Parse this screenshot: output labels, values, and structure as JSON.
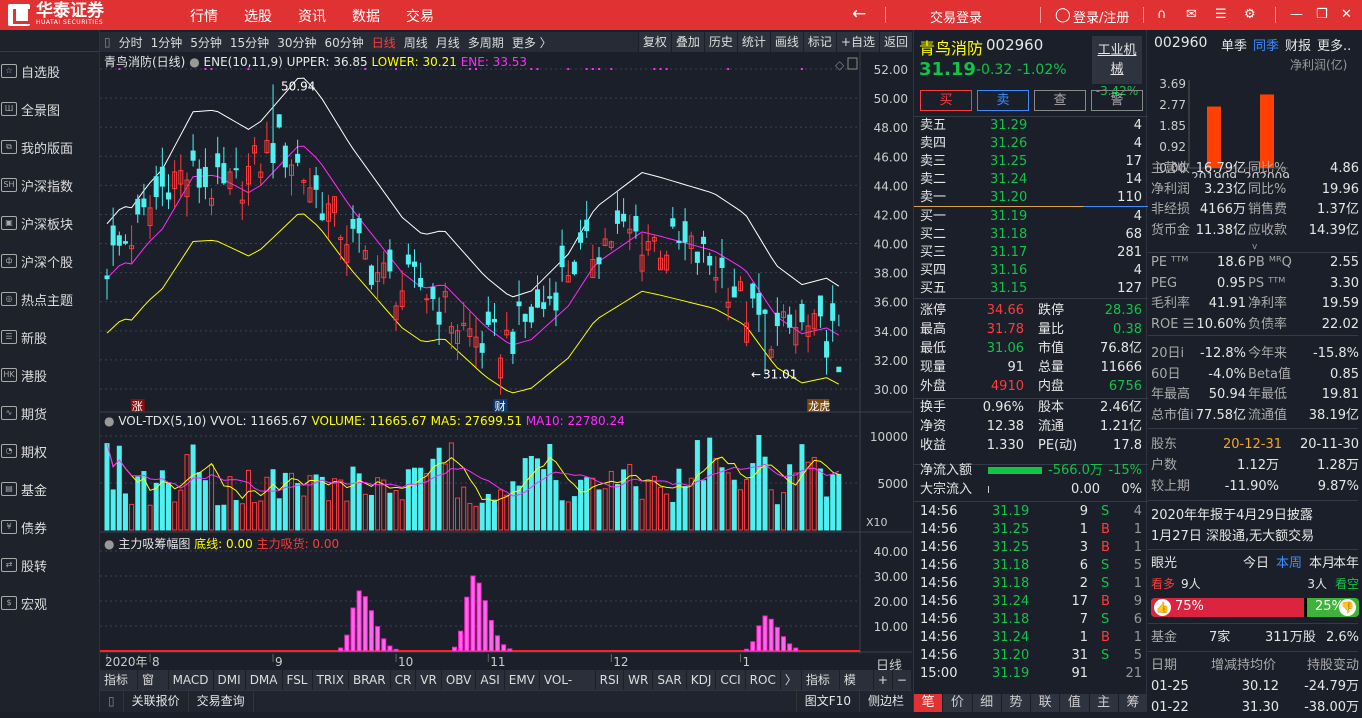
{
  "top": {
    "brand": "华泰证券",
    "brand_en": "HUATAI SECURITIES",
    "nav": [
      "行情",
      "选股",
      "资讯",
      "数据",
      "交易"
    ],
    "trade_login": "交易登录",
    "login": "登录/注册"
  },
  "sidebar": [
    "自选股",
    "全景图",
    "我的版面",
    "沪深指数",
    "沪深板块",
    "沪深个股",
    "热点主题",
    "新股",
    "港股",
    "期货",
    "期权",
    "基金",
    "债券",
    "股转",
    "宏观"
  ],
  "sidebar_icons": [
    "☆",
    "Ш",
    "⧉",
    "SH",
    "▣",
    "ф",
    "◎",
    "☰",
    "HK",
    "∿",
    "◔",
    "▤",
    "¥",
    "⇄",
    "$"
  ],
  "toolbar": {
    "periods": [
      "分时",
      "1分钟",
      "5分钟",
      "15分钟",
      "30分钟",
      "60分钟",
      "日线",
      "周线",
      "月线",
      "多周期",
      "更多 〉"
    ],
    "active": 6,
    "right": [
      "复权",
      "叠加",
      "历史",
      "统计",
      "画线",
      "标记",
      "+自选",
      "返回"
    ]
  },
  "main": {
    "title": "青鸟消防(日线)",
    "ind": "ENE(10,11,9)",
    "upper": "UPPER: 36.85",
    "lower": "LOWER: 30.21",
    "ene": "ENE: 33.53",
    "high_label": "50.94",
    "low_label": "31.01",
    "markers": [
      "涨",
      "财",
      "龙虎"
    ],
    "yticks": [
      "52.00",
      "50.00",
      "48.00",
      "46.00",
      "44.00",
      "42.00",
      "40.00",
      "38.00",
      "36.00",
      "34.00",
      "32.00",
      "30.00"
    ]
  },
  "chart_data": {
    "type": "candlestick",
    "ylim": [
      30,
      52
    ],
    "days": 120,
    "ene_mid_points": [
      [
        0,
        37.6
      ],
      [
        2.5,
        38.7
      ],
      [
        4,
        38.6
      ],
      [
        6.6,
        40
      ],
      [
        9,
        41
      ],
      [
        14,
        44.6
      ],
      [
        17.6,
        44.7
      ],
      [
        23,
        43.5
      ],
      [
        25,
        44
      ],
      [
        31.5,
        46.9
      ],
      [
        34.5,
        45.7
      ],
      [
        39.6,
        42.5
      ],
      [
        48,
        38
      ],
      [
        51.4,
        36.9
      ],
      [
        54.8,
        37.2
      ],
      [
        61.5,
        34.3
      ],
      [
        65.7,
        33
      ],
      [
        69,
        33.4
      ],
      [
        75,
        35.7
      ],
      [
        79.4,
        38.6
      ],
      [
        87,
        40.8
      ],
      [
        90,
        40.5
      ],
      [
        98.7,
        39.5
      ],
      [
        103.8,
        38.2
      ],
      [
        108.8,
        35
      ],
      [
        113,
        33.8
      ],
      [
        117,
        34.2
      ],
      [
        119.8,
        33.5
      ]
    ],
    "upper_ratio": 1.1,
    "lower_ratio": 0.9,
    "high": 50.94,
    "low": 31.01,
    "last_close": 31.19,
    "xticks": [
      {
        "i": 0,
        "label": "2020年"
      },
      {
        "i": 7,
        "label": "8"
      },
      {
        "i": 27,
        "label": "9"
      },
      {
        "i": 47,
        "label": "10"
      },
      {
        "i": 62,
        "label": "11"
      },
      {
        "i": 82,
        "label": "12"
      },
      {
        "i": 103,
        "label": "1"
      }
    ],
    "main_clusters": [
      {
        "c": 41,
        "peak": 24
      },
      {
        "c": 59.5,
        "peak": 30
      },
      {
        "c": 107,
        "peak": 14
      }
    ]
  },
  "vol": {
    "title": "VOL-TDX(5,10)",
    "vvol": "VVOL: 11665.67",
    "volume": "VOLUME: 11665.67",
    "ma5": "MA5: 27699.51",
    "ma10": "MA10: 22780.24",
    "yticks": [
      "10000",
      "5000"
    ],
    "unit": "X10"
  },
  "ind2": {
    "title": "主力吸筹幅图",
    "base": "底线: 0.00",
    "absorb": "主力吸货: 0.00",
    "yticks": [
      "40.00",
      "30.00",
      "20.00",
      "10.00"
    ]
  },
  "xaxis_right": "日线",
  "ind_tabs": [
    "指标A",
    "窗口",
    "MACD",
    "DMI",
    "DMA",
    "FSL",
    "TRIX",
    "BRAR",
    "CR",
    "VR",
    "OBV",
    "ASI",
    "EMV",
    "VOL-TDX",
    "RSI",
    "WR",
    "SAR",
    "KDJ",
    "CCI",
    "ROC",
    "〉",
    "指标B",
    "模 板",
    "+",
    "−"
  ],
  "bottom": {
    "left": [
      "关联报价",
      "交易查询"
    ],
    "right": [
      "图文F10",
      "侧边栏"
    ]
  },
  "quote": {
    "name": "青鸟消防",
    "code": "002960",
    "price": "31.19",
    "change": "-0.32",
    "pct": "-1.02%",
    "sector": "工业机械",
    "sector_pct": "-3.42%",
    "buttons": [
      "买",
      "卖",
      "查",
      "警"
    ],
    "sells": [
      [
        "卖五",
        "31.29",
        "4"
      ],
      [
        "卖四",
        "31.26",
        "4"
      ],
      [
        "卖三",
        "31.25",
        "17"
      ],
      [
        "卖二",
        "31.24",
        "14"
      ],
      [
        "卖一",
        "31.20",
        "110"
      ]
    ],
    "buys": [
      [
        "买一",
        "31.19",
        "4"
      ],
      [
        "买二",
        "31.18",
        "68"
      ],
      [
        "买三",
        "31.17",
        "281"
      ],
      [
        "买四",
        "31.16",
        "4"
      ],
      [
        "买五",
        "31.15",
        "127"
      ]
    ],
    "stats": [
      [
        "涨停",
        "34.66",
        "r",
        "跌停",
        "28.36",
        "g"
      ],
      [
        "最高",
        "31.78",
        "r",
        "量比",
        "0.38",
        "g"
      ],
      [
        "最低",
        "31.06",
        "g",
        "市值",
        "76.8亿",
        "w"
      ],
      [
        "现量",
        "91",
        "w",
        "总量",
        "11666",
        "w"
      ],
      [
        "外盘",
        "4910",
        "r",
        "内盘",
        "6756",
        "g"
      ]
    ],
    "stats2": [
      [
        "换手",
        "0.96%",
        "股本",
        "2.46亿"
      ],
      [
        "净资",
        "12.38",
        "流通",
        "1.21亿"
      ],
      [
        "收益",
        "1.330",
        "PE(动)",
        "17.8"
      ]
    ],
    "flow": [
      [
        "净流入额",
        "-566.0万",
        "-15%"
      ],
      [
        "大宗流入",
        "0.00",
        "0%"
      ]
    ],
    "flow_fill": 0.6,
    "ticks": [
      [
        "14:56",
        "31.19",
        "9",
        "S",
        "4"
      ],
      [
        "14:56",
        "31.25",
        "1",
        "B",
        "1"
      ],
      [
        "14:56",
        "31.25",
        "3",
        "B",
        "1"
      ],
      [
        "14:56",
        "31.18",
        "6",
        "S",
        "5"
      ],
      [
        "14:56",
        "31.18",
        "2",
        "S",
        "1"
      ],
      [
        "14:56",
        "31.24",
        "17",
        "B",
        "9"
      ],
      [
        "14:56",
        "31.18",
        "7",
        "S",
        "6"
      ],
      [
        "14:56",
        "31.24",
        "1",
        "B",
        "1"
      ],
      [
        "14:56",
        "31.20",
        "31",
        "S",
        "5"
      ],
      [
        "15:00",
        "31.19",
        "91",
        "",
        "21"
      ]
    ],
    "tabs": [
      "笔",
      "价",
      "细",
      "势",
      "联",
      "值",
      "主",
      "筹"
    ]
  },
  "right": {
    "code": "002960",
    "tabs": [
      "单季",
      "同季",
      "财报",
      "更多.."
    ],
    "active_tab": 1,
    "chart_title": "净利润(亿)",
    "chart_yticks": [
      "3.69",
      "2.77",
      "1.85",
      "0.92",
      "0.00"
    ],
    "bars": [
      {
        "label": "201909",
        "value": 2.7
      },
      {
        "label": "202009",
        "value": 3.23
      }
    ],
    "fund": [
      [
        "主营收",
        "16.79亿",
        "同比%",
        "4.86"
      ],
      [
        "净利润",
        "3.23亿",
        "同比%",
        "19.96"
      ],
      [
        "非经损",
        "4166万",
        "销售费",
        "1.37亿"
      ],
      [
        "货币金",
        "11.38亿",
        "应收款",
        "14.39亿"
      ]
    ],
    "val": [
      [
        "PE ᵀᵀᴹ",
        "18.6",
        "PB ᴹᴿQ",
        "2.55"
      ],
      [
        "PEG",
        "0.95",
        "PS ᵀᵀᴹ",
        "3.30"
      ],
      [
        "毛利率",
        "41.91",
        "净利率",
        "19.59"
      ],
      [
        "ROE ☰",
        "10.60%",
        "负债率",
        "22.02"
      ]
    ],
    "perf": [
      [
        "20日i",
        "-12.8%",
        "今年来",
        "-15.8%"
      ],
      [
        "60日",
        "-4.0%",
        "Beta值",
        "0.85"
      ],
      [
        "年最高",
        "50.94",
        "年最低",
        "19.81"
      ],
      [
        "总市值i",
        "77.58亿",
        "流通值",
        "38.19亿"
      ]
    ],
    "holders": {
      "label": "股东",
      "d1": "20-12-31",
      "d2": "20-11-30",
      "rows": [
        [
          "户数",
          "1.12万",
          "1.28万"
        ],
        [
          "较上期",
          "-11.90%",
          "9.87%"
        ]
      ]
    },
    "notes": [
      "2020年年报于4月29日披露",
      "1月27日 深股通,无大额交易"
    ],
    "vision": {
      "label": "眼光",
      "periods": [
        "今日",
        "本周",
        "本月",
        "本年"
      ],
      "active": 1,
      "bull": "看多",
      "bull_n": "9人",
      "bear_n": "3人",
      "bear": "看空",
      "bull_pct": "75%",
      "bear_pct": "25%",
      "bull_frac": 0.75
    },
    "fund_hold": {
      "label": "基金",
      "n": "7家",
      "shares": "311万股",
      "pct": "2.6%"
    },
    "changes": {
      "headers": [
        "日期",
        "增减持均价",
        "持股变动"
      ],
      "rows": [
        [
          "01-25",
          "30.12",
          "-24.79万"
        ],
        [
          "01-22",
          "31.30",
          "-38.00万"
        ]
      ]
    }
  },
  "colors": {
    "up": "#ff3b3b",
    "down": "#4ef0f0",
    "ene": "#ff2bff",
    "upper": "#ffffff",
    "lower": "#ffff00",
    "accent": "#e03233"
  }
}
